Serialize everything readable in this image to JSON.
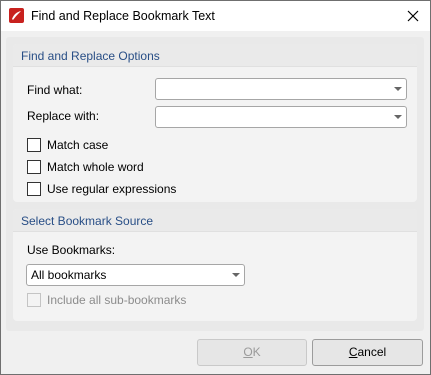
{
  "window": {
    "title": "Find and Replace Bookmark Text",
    "app_icon": "pdf-app-icon",
    "close_icon": "close-icon"
  },
  "find_replace_group": {
    "title": "Find and Replace Options",
    "find_label": "Find what:",
    "find_value": "",
    "replace_label": "Replace with:",
    "replace_value": "",
    "options": [
      {
        "label": "Match case",
        "checked": false
      },
      {
        "label": "Match whole word",
        "checked": false
      },
      {
        "label": "Use regular expressions",
        "checked": false
      }
    ]
  },
  "source_group": {
    "title": "Select Bookmark Source",
    "use_bookmarks_label": "Use Bookmarks:",
    "use_bookmarks_value": "All bookmarks",
    "include_sub_label": "Include all sub-bookmarks",
    "include_sub_checked": false,
    "include_sub_enabled": false
  },
  "buttons": {
    "ok_first": "O",
    "ok_rest": "K",
    "ok_enabled": false,
    "cancel_first": "C",
    "cancel_rest": "ancel"
  },
  "colors": {
    "group_title": "#284e86",
    "app_icon_bg": "#c8211e"
  }
}
